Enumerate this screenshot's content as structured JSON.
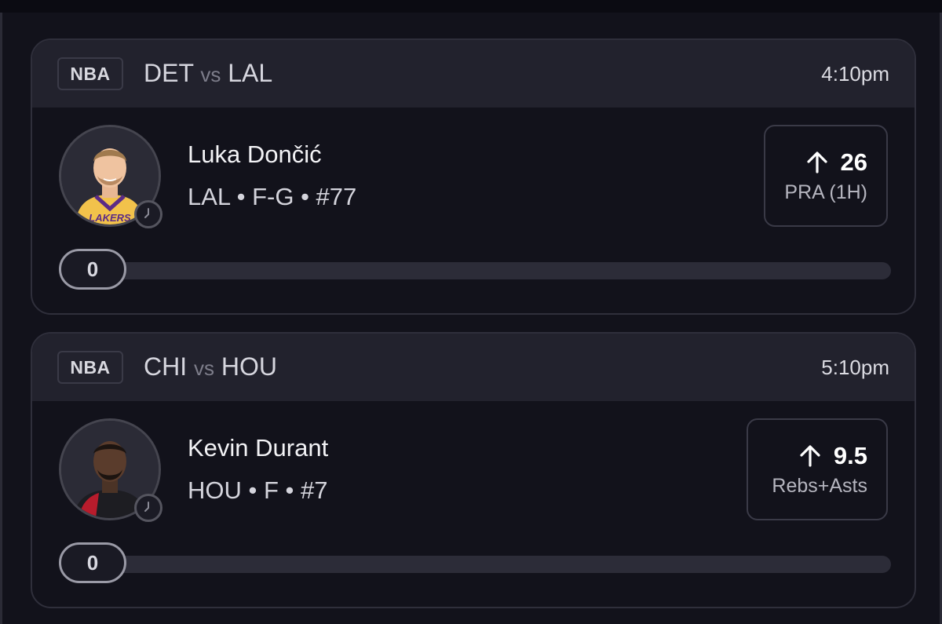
{
  "cards": [
    {
      "league": "NBA",
      "team_away": "DET",
      "vs": "vs",
      "team_home": "LAL",
      "time": "4:10pm",
      "player_name": "Luka Dončić",
      "player_meta": "LAL • F-G • #77",
      "jersey_color": "#f2c24b",
      "prop_value": "26",
      "prop_direction": "over",
      "prop_label": "PRA (1H)",
      "progress_value": "0"
    },
    {
      "league": "NBA",
      "team_away": "CHI",
      "vs": "vs",
      "team_home": "HOU",
      "time": "5:10pm",
      "player_name": "Kevin Durant",
      "player_meta": "HOU • F • #7",
      "jersey_color": "#b81c2c",
      "prop_value": "9.5",
      "prop_direction": "over",
      "prop_label": "Rebs+Asts",
      "progress_value": "0"
    }
  ],
  "icons": {
    "prop_arrow": "arrow-up-icon",
    "status": "clock-icon"
  },
  "colors": {
    "background": "#12121b",
    "header": "#22222d",
    "track": "#2c2c38"
  }
}
